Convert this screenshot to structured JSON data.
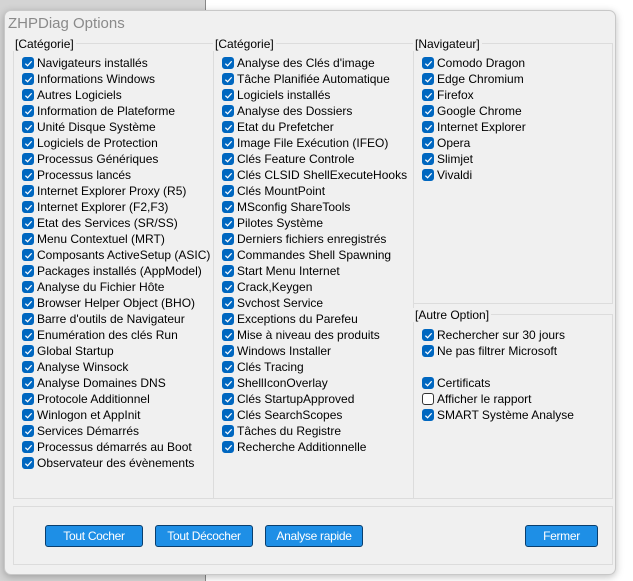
{
  "window": {
    "title": "ZHPDiag Options"
  },
  "groups": {
    "cat1": {
      "label": "[Catégorie]",
      "items": [
        {
          "label": "Navigateurs installés",
          "checked": true
        },
        {
          "label": "Informations Windows",
          "checked": true
        },
        {
          "label": "Autres Logiciels",
          "checked": true
        },
        {
          "label": "Information de Plateforme",
          "checked": true
        },
        {
          "label": "Unité Disque Système",
          "checked": true
        },
        {
          "label": "Logiciels de Protection",
          "checked": true
        },
        {
          "label": "Processus Génériques",
          "checked": true
        },
        {
          "label": "Processus lancés",
          "checked": true
        },
        {
          "label": "Internet Explorer Proxy (R5)",
          "checked": true
        },
        {
          "label": "Internet Explorer (F2,F3)",
          "checked": true
        },
        {
          "label": "Etat des Services (SR/SS)",
          "checked": true
        },
        {
          "label": "Menu Contextuel (MRT)",
          "checked": true
        },
        {
          "label": "Composants ActiveSetup (ASIC)",
          "checked": true
        },
        {
          "label": "Packages installés (AppModel)",
          "checked": true
        },
        {
          "label": "Analyse du Fichier Hôte",
          "checked": true
        },
        {
          "label": "Browser Helper Object (BHO)",
          "checked": true
        },
        {
          "label": "Barre d'outils de Navigateur",
          "checked": true
        },
        {
          "label": "Enumération des clés Run",
          "checked": true
        },
        {
          "label": "Global Startup",
          "checked": true
        },
        {
          "label": "Analyse Winsock",
          "checked": true
        },
        {
          "label": "Analyse Domaines DNS",
          "checked": true
        },
        {
          "label": "Protocole Additionnel",
          "checked": true
        },
        {
          "label": "Winlogon et AppInit",
          "checked": true
        },
        {
          "label": "Services Démarrés",
          "checked": true
        },
        {
          "label": "Processus démarrés au Boot",
          "checked": true
        },
        {
          "label": "Observateur des évènements",
          "checked": true
        }
      ]
    },
    "cat2": {
      "label": "[Catégorie]",
      "items": [
        {
          "label": "Analyse des Clés d'image",
          "checked": true
        },
        {
          "label": "Tâche Planifiée Automatique",
          "checked": true
        },
        {
          "label": "Logiciels installés",
          "checked": true
        },
        {
          "label": "Analyse des Dossiers",
          "checked": true
        },
        {
          "label": "Etat du Prefetcher",
          "checked": true
        },
        {
          "label": "Image File Exécution (IFEO)",
          "checked": true
        },
        {
          "label": "Clés Feature Controle",
          "checked": true
        },
        {
          "label": "Clés CLSID ShellExecuteHooks",
          "checked": true
        },
        {
          "label": "Clés MountPoint",
          "checked": true
        },
        {
          "label": "MSconfig ShareTools",
          "checked": true
        },
        {
          "label": "Pilotes Système",
          "checked": true
        },
        {
          "label": "Derniers fichiers enregistrés",
          "checked": true
        },
        {
          "label": "Commandes Shell Spawning",
          "checked": true
        },
        {
          "label": "Start Menu Internet",
          "checked": true
        },
        {
          "label": "Crack,Keygen",
          "checked": true
        },
        {
          "label": "Svchost Service",
          "checked": true
        },
        {
          "label": "Exceptions du Parefeu",
          "checked": true
        },
        {
          "label": "Mise à niveau des produits",
          "checked": true
        },
        {
          "label": "Windows Installer",
          "checked": true
        },
        {
          "label": "Clés Tracing",
          "checked": true
        },
        {
          "label": "ShellIconOverlay",
          "checked": true
        },
        {
          "label": "Clés StartupApproved",
          "checked": true
        },
        {
          "label": "Clés SearchScopes",
          "checked": true
        },
        {
          "label": "Tâches du Registre",
          "checked": true
        },
        {
          "label": "Recherche Additionnelle",
          "checked": true
        }
      ]
    },
    "nav": {
      "label": "[Navigateur]",
      "items": [
        {
          "label": "Comodo Dragon",
          "checked": true
        },
        {
          "label": "Edge Chromium",
          "checked": true
        },
        {
          "label": "Firefox",
          "checked": true
        },
        {
          "label": "Google Chrome",
          "checked": true
        },
        {
          "label": "Internet Explorer",
          "checked": true
        },
        {
          "label": "Opera",
          "checked": true
        },
        {
          "label": "Slimjet",
          "checked": true
        },
        {
          "label": "Vivaldi",
          "checked": true
        }
      ]
    },
    "other": {
      "label": "[Autre Option]",
      "items": [
        {
          "label": "Rechercher sur 30 jours",
          "checked": true
        },
        {
          "label": "Ne pas filtrer Microsoft",
          "checked": true
        },
        null,
        {
          "label": "Certificats",
          "checked": true
        },
        {
          "label": "Afficher le rapport",
          "checked": false
        },
        {
          "label": "SMART Système Analyse",
          "checked": true
        }
      ]
    }
  },
  "buttons": {
    "check_all": "Tout Cocher",
    "uncheck_all": "Tout Décocher",
    "quick_scan": "Analyse rapide",
    "close": "Fermer"
  },
  "colors": {
    "accent": "#0067c0",
    "button": "#1e8fe6"
  }
}
